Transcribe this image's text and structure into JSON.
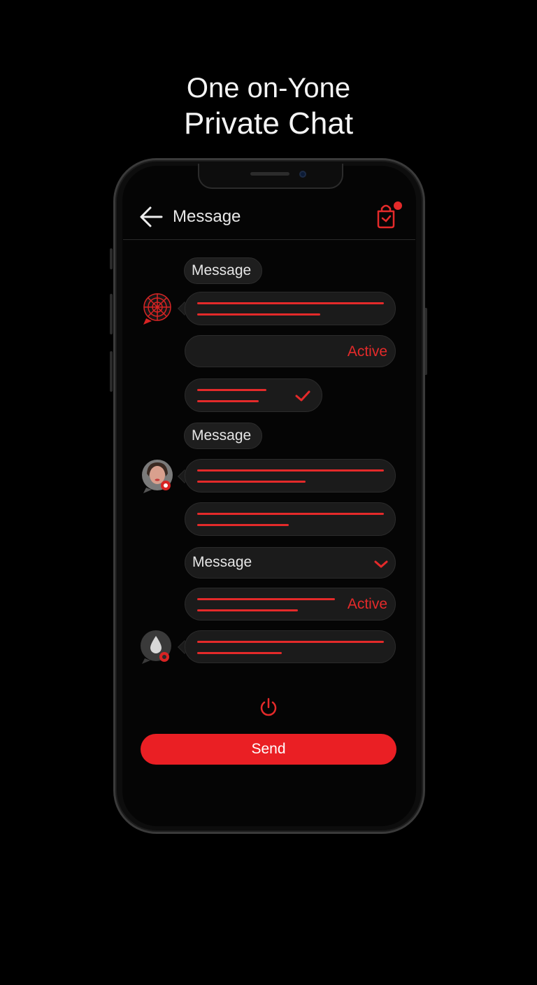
{
  "headline": {
    "line1": "One on-Yone",
    "line2": "Private Chat"
  },
  "header": {
    "title": "Message",
    "back_icon": "arrow-left-icon",
    "right_icon": "shopping-bag-icon"
  },
  "colors": {
    "accent": "#e42a2a",
    "background": "#000000",
    "bubble": "#1b1b1b"
  },
  "chat": {
    "label_1": "Message",
    "status_1": "Active",
    "label_2": "Message",
    "dropdown_label": "Message",
    "status_2": "Active"
  },
  "actions": {
    "send_label": "Send",
    "power_icon": "power-icon"
  }
}
